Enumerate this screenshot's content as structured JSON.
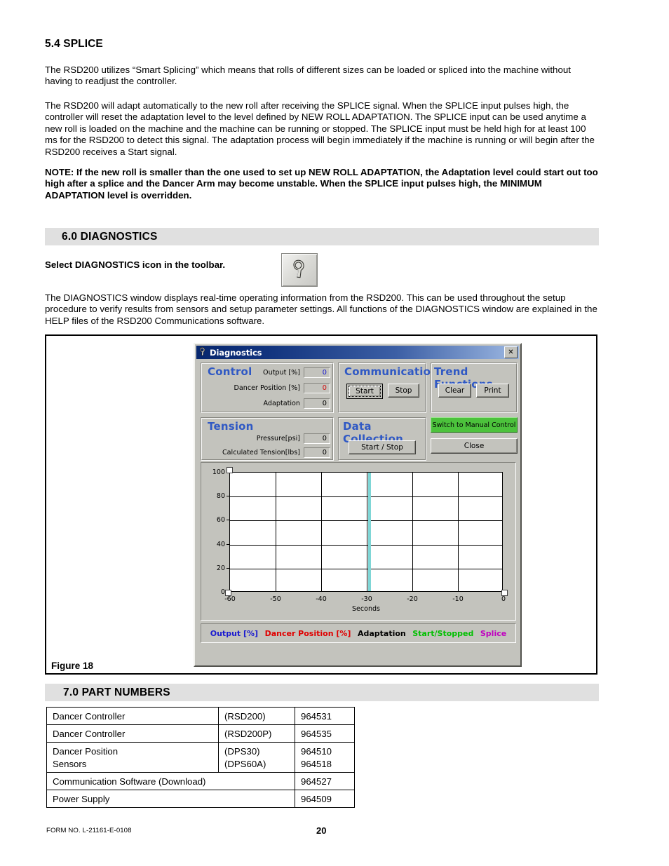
{
  "document": {
    "section_54_title": "5.4 SPLICE",
    "para1": "The RSD200 utilizes “Smart Splicing” which means that rolls of different sizes can be loaded or spliced into the machine without having to readjust the controller.",
    "para2": "The RSD200 will adapt automatically to the new roll after receiving the SPLICE signal. When the SPLICE input pulses high, the controller will reset the adaptation level to the level defined by NEW ROLL ADAPTATION. The SPLICE input can be used anytime a new roll is loaded on the machine and the machine can be running or stopped. The SPLICE input must be held high for at least 100 ms for the RSD200 to detect this signal. The adaptation process will begin immediately if the machine is running or will begin after the RSD200 receives a Start signal.",
    "note": "NOTE: If the new roll is smaller than the one used to set up NEW ROLL ADAPTATION, the Adaptation level could start out too high after a splice and the Dancer Arm may become unstable. When the SPLICE input pulses high, the MINIMUM ADAPTATION level is overridden.",
    "section_60_title": "6.0 DIAGNOSTICS",
    "select_icon_text": "Select DIAGNOSTICS icon in the toolbar.",
    "para3": "The DIAGNOSTICS window displays real-time operating information from the RSD200.  This can be used throughout the setup procedure to verify results from sensors and setup parameter settings.  All functions of the DIAGNOSTICS window are explained in the HELP files of the RSD200 Communications software.",
    "figure_caption": "Figure 18",
    "section_70_title": "7.0 PART NUMBERS"
  },
  "dialog": {
    "title": "Diagnostics",
    "close_label": "✕",
    "control": {
      "title": "Control",
      "fields": [
        {
          "label": "Output [%]",
          "value": "0",
          "color": "#1a1ad0"
        },
        {
          "label": "Dancer Position [%]",
          "value": "0",
          "color": "#d01010"
        },
        {
          "label": "Adaptation",
          "value": "0",
          "color": "#000000"
        }
      ]
    },
    "tension": {
      "title": "Tension",
      "fields": [
        {
          "label": "Pressure[psi]",
          "value": "0",
          "color": "#000000"
        },
        {
          "label": "Calculated Tension[lbs]",
          "value": "0",
          "color": "#000000"
        }
      ]
    },
    "communication": {
      "title": "Communication",
      "start_label": "Start",
      "stop_label": "Stop"
    },
    "data_collection": {
      "title": "Data Collection",
      "start_stop_label": "Start / Stop"
    },
    "trend_functions": {
      "title": "Trend  Functions",
      "clear_label": "Clear",
      "print_label": "Print"
    },
    "switch_manual_label": "Switch to Manual Control",
    "close_button_label": "Close",
    "switch_manual_color": "#4cc23c"
  },
  "chart_data": {
    "type": "line",
    "title": "",
    "xlabel": "Seconds",
    "ylabel": "",
    "xlim": [
      -60,
      0
    ],
    "ylim": [
      0,
      100
    ],
    "xticks": [
      "-60",
      "-50",
      "-40",
      "-30",
      "-20",
      "-10",
      "0"
    ],
    "yticks": [
      "0",
      "20",
      "40",
      "60",
      "80",
      "100"
    ],
    "grid": true,
    "legend_position": "bottom",
    "cursor_line_seconds": -29.5,
    "cursor_line_color": "#7fd6d6",
    "series": [
      {
        "name": "Output [%]",
        "color": "#1a1ad0",
        "values": []
      },
      {
        "name": "Dancer Position [%]",
        "color": "#e00000",
        "values": []
      },
      {
        "name": "Adaptation",
        "color": "#000000",
        "values": []
      },
      {
        "name": "Start/Stopped",
        "color": "#00c000",
        "values": []
      },
      {
        "name": "Splice",
        "color": "#c000c0",
        "values": []
      }
    ]
  },
  "part_numbers": {
    "rows": [
      {
        "desc": "Dancer Controller",
        "model": "(RSD200)",
        "num": "964531"
      },
      {
        "desc": "Dancer Controller",
        "model": "(RSD200P)",
        "num": "964535"
      },
      {
        "desc": "Dancer Position",
        "model": "(DPS30)",
        "num": "964510"
      },
      {
        "desc": "Sensors",
        "model": "(DPS60A)",
        "num": "964518"
      },
      {
        "desc": "Communication Software (Download)",
        "model": "",
        "num": "964527"
      },
      {
        "desc": "Power Supply",
        "model": "",
        "num": "964509"
      }
    ]
  },
  "footer": {
    "form_no": "FORM NO. L-21161-E-0108",
    "page": "20"
  }
}
